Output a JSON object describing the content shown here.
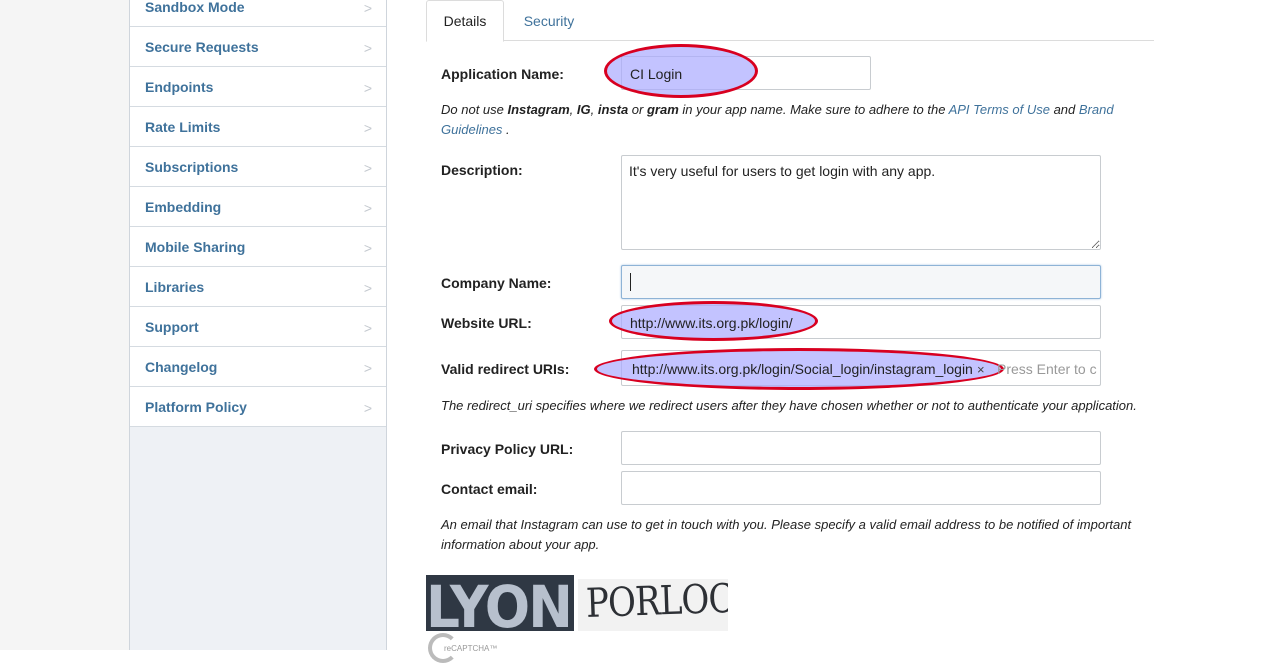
{
  "sidebar": {
    "items": [
      {
        "label": "Sandbox Mode"
      },
      {
        "label": "Secure Requests"
      },
      {
        "label": "Endpoints"
      },
      {
        "label": "Rate Limits"
      },
      {
        "label": "Subscriptions"
      },
      {
        "label": "Embedding"
      },
      {
        "label": "Mobile Sharing"
      },
      {
        "label": "Libraries"
      },
      {
        "label": "Support"
      },
      {
        "label": "Changelog"
      },
      {
        "label": "Platform Policy"
      }
    ],
    "chevron": ">"
  },
  "tabs": {
    "details": "Details",
    "security": "Security"
  },
  "form": {
    "app_name": {
      "label": "Application Name:",
      "value": "CI Login"
    },
    "app_name_help": {
      "t1": "Do not use ",
      "b1": "Instagram",
      "t2": ", ",
      "b2": "IG",
      "t3": ", ",
      "b3": "insta",
      "t4": " or ",
      "b4": "gram",
      "t5": " in your app name. Make sure to adhere to the ",
      "link1": "API Terms of Use",
      "t6": " and ",
      "link2": "Brand Guidelines",
      "t7": " ."
    },
    "description": {
      "label": "Description:",
      "value": "It's very useful for users to get login with any app."
    },
    "company": {
      "label": "Company Name:",
      "value": ""
    },
    "website": {
      "label": "Website URL:",
      "value": "http://www.its.org.pk/login/"
    },
    "redirect": {
      "label": "Valid redirect URIs:",
      "tag": "http://www.its.org.pk/login/Social_login/instagram_login",
      "remove": "×",
      "placeholder": "Press Enter to c"
    },
    "redirect_help": "The redirect_uri specifies where we redirect users after they have chosen whether or not to authenticate your application.",
    "privacy": {
      "label": "Privacy Policy URL:",
      "value": ""
    },
    "contact": {
      "label": "Contact email:",
      "value": ""
    },
    "contact_help": "An email that Instagram can use to get in touch with you. Please specify a valid email address to be notified of important information about your app."
  },
  "captcha": {
    "word1": "LYON",
    "word2": "PORLOCK",
    "brand": "reCAPTCHA™"
  },
  "colors": {
    "link": "#3f729b",
    "highlight_fill": "#aaaaff",
    "highlight_stroke": "#d80020"
  }
}
